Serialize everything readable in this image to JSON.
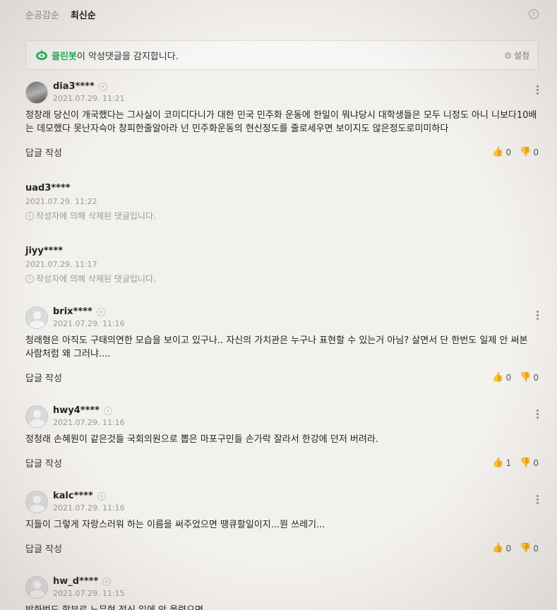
{
  "sort": {
    "tabs": [
      {
        "label": "순공감순",
        "active": false
      },
      {
        "label": "최신순",
        "active": true
      }
    ],
    "info_icon": "i"
  },
  "cleanbot": {
    "brand": "클린봇",
    "text": "이 악성댓글을 감지합니다.",
    "settings_label": "설정",
    "brand_color": "#1ab25a"
  },
  "labels": {
    "reply": "답글 작성",
    "up_icon": "👍",
    "down_icon": "👎",
    "arrow": "›",
    "info": "i"
  },
  "comments": [
    {
      "username": "dia3****",
      "date": "2021.07.29. 11:21",
      "text": "정창래 당신이 개국했다는 그사실이 코미디다니가 대한 민국 민주화 운동에 한일이 뭐냐당시 대학생들은 모두 니정도 아니 니보다10배는 데모했다 못난자슥아 창피한줄알아라 넌 민주화운동의 현신정도를 줄로세우면 보이지도 않은정도로미미하다",
      "up": "0",
      "down": "0"
    },
    {
      "username": "uad3****",
      "date": "2021.07.29. 11:22",
      "deleted_message": "작성자에 의해 삭제된 댓글입니다."
    },
    {
      "username": "jiyy****",
      "date": "2021.07.29. 11:17",
      "deleted_message": "작성자에 의해 삭제된 댓글입니다."
    },
    {
      "username": "brix****",
      "date": "2021.07.29. 11:16",
      "text": "청래형은 아직도 구태의연한 모습을 보이고 있구나.. 자신의 가치관은 누구나 표현할 수 있는거 아님? 살면서 단 한번도 일제 안 써본 사람처럼 왜 그러냐....",
      "up": "0",
      "down": "0"
    },
    {
      "username": "hwy4****",
      "date": "2021.07.29. 11:16",
      "text": "정청래 손혜원이 같은것들 국회의원으로 뽑은 마포구민들 손가락 잘라서 한강에 던저 버려라.",
      "up": "1",
      "down": "0"
    },
    {
      "username": "kalc****",
      "date": "2021.07.29. 11:16",
      "text": "지들이 그렇게 자랑스러워 하는 이름을 써주었으면 땡큐할일이지...뭔 쓰레기...",
      "up": "0",
      "down": "0"
    },
    {
      "username": "hw_d****",
      "date": "2021.07.29. 11:15",
      "text": "방화범도 함부로 노무현 정신 입에 안 올렸으면..."
    }
  ]
}
